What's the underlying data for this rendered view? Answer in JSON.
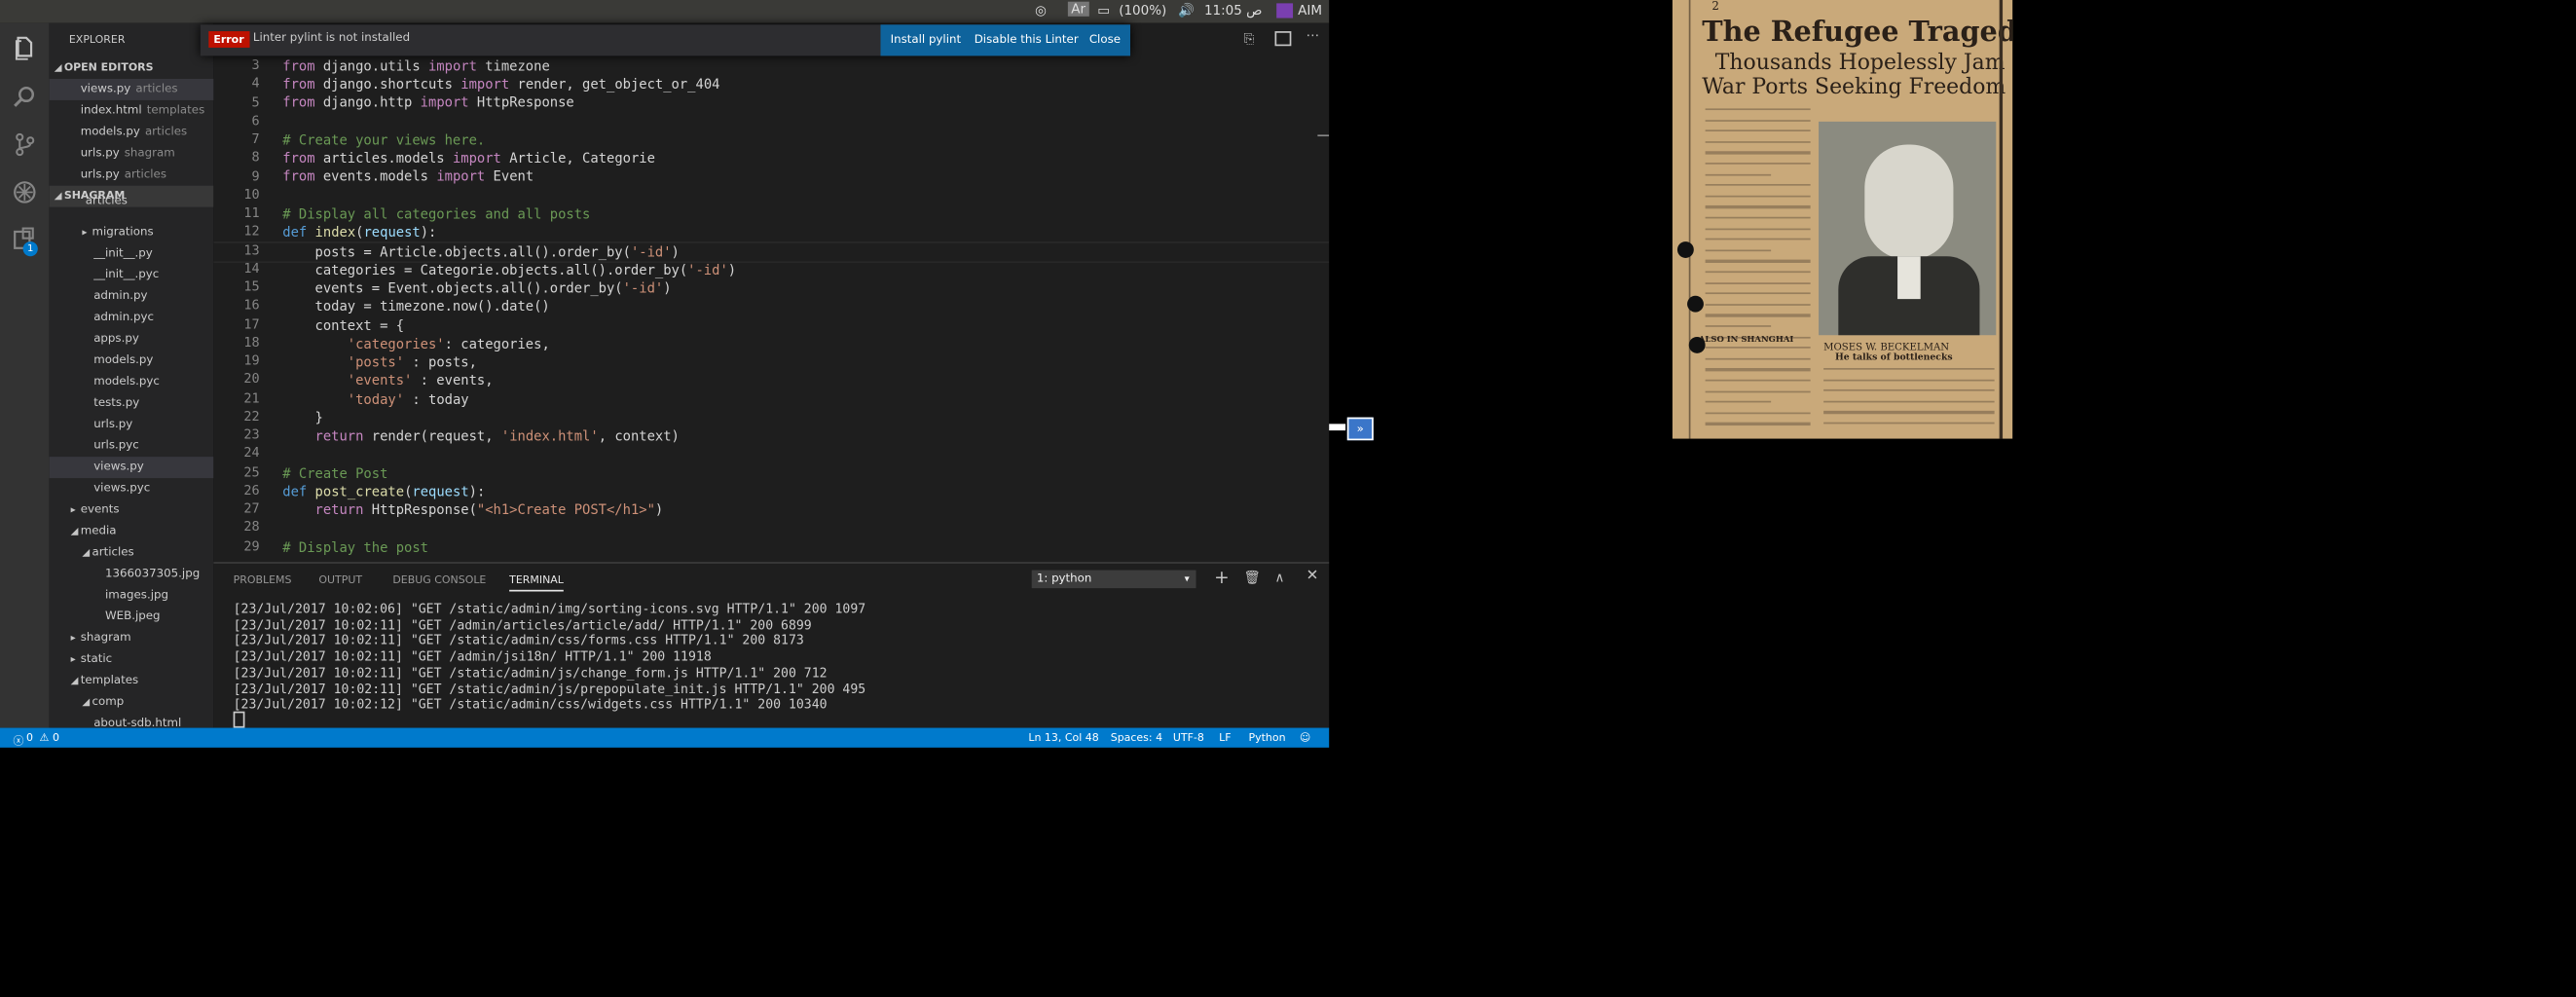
{
  "system_bar": {
    "battery": "(100%)",
    "time": "11:05 ص",
    "user": "AIM",
    "indicator": "Ar"
  },
  "activity_bar": {
    "icons": [
      "files-icon",
      "search-icon",
      "source-control-icon",
      "debug-icon",
      "extensions-icon"
    ],
    "extensions_badge": "1"
  },
  "sidebar": {
    "title": "EXPLORER",
    "open_editors_title": "OPEN EDITORS",
    "open_editors": [
      {
        "name": "views.py",
        "desc": "articles"
      },
      {
        "name": "index.html",
        "desc": "templates"
      },
      {
        "name": "models.py",
        "desc": "articles"
      },
      {
        "name": "urls.py",
        "desc": "shagram"
      },
      {
        "name": "urls.py",
        "desc": "articles"
      }
    ],
    "project_title": "SHAGRAM",
    "tree": [
      "articles",
      "migrations",
      "__init__.py",
      "__init__.pyc",
      "admin.py",
      "admin.pyc",
      "apps.py",
      "models.py",
      "models.pyc",
      "tests.py",
      "urls.py",
      "urls.pyc",
      "views.py",
      "views.pyc",
      "events",
      "media",
      "articles",
      "1366037305.jpg",
      "images.jpg",
      "WEB.jpeg",
      "shagram",
      "static",
      "templates",
      "comp",
      "about-sdb.html"
    ]
  },
  "notification": {
    "badge": "Error",
    "message": "Linter pylint is not installed",
    "install": "Install pylint",
    "disable": "Disable this Linter",
    "close": "Close"
  },
  "editor": {
    "line_numbers": [
      "3",
      "4",
      "5",
      "6",
      "7",
      "8",
      "9",
      "10",
      "11",
      "12",
      "13",
      "14",
      "15",
      "16",
      "17",
      "18",
      "19",
      "20",
      "21",
      "22",
      "23",
      "24",
      "25",
      "26",
      "27",
      "28",
      "29"
    ]
  },
  "panel": {
    "tabs": [
      "PROBLEMS",
      "OUTPUT",
      "DEBUG CONSOLE",
      "TERMINAL"
    ],
    "terminal_select": "1: python",
    "lines": [
      "[23/Jul/2017 10:02:06] \"GET /static/admin/img/sorting-icons.svg HTTP/1.1\" 200 1097",
      "[23/Jul/2017 10:02:11] \"GET /admin/articles/article/add/ HTTP/1.1\" 200 6899",
      "[23/Jul/2017 10:02:11] \"GET /static/admin/css/forms.css HTTP/1.1\" 200 8173",
      "[23/Jul/2017 10:02:11] \"GET /admin/jsi18n/ HTTP/1.1\" 200 11918",
      "[23/Jul/2017 10:02:11] \"GET /static/admin/js/change_form.js HTTP/1.1\" 200 712",
      "[23/Jul/2017 10:02:11] \"GET /static/admin/js/prepopulate_init.js HTTP/1.1\" 200 495",
      "[23/Jul/2017 10:02:12] \"GET /static/admin/css/widgets.css HTTP/1.1\" 200 10340"
    ]
  },
  "status_bar": {
    "errors": "0",
    "warnings": "0",
    "position": "Ln 13, Col 48",
    "spaces": "Spaces: 4",
    "encoding": "UTF-8",
    "eol": "LF",
    "language": "Python"
  },
  "newspaper": {
    "page_number": "2",
    "headline": "The Refugee Tragedy",
    "subhead_1": "Thousands Hopelessly Jam",
    "subhead_2": "War Ports Seeking Freedom",
    "caption_name": "MOSES W. BECKELMAN",
    "caption_sub": "He talks of bottlenecks",
    "section": "ALSO IN SHANGHAI"
  },
  "colors": {
    "accent": "#007acc",
    "error_badge": "#be1100",
    "notification_button": "#0e639c"
  }
}
